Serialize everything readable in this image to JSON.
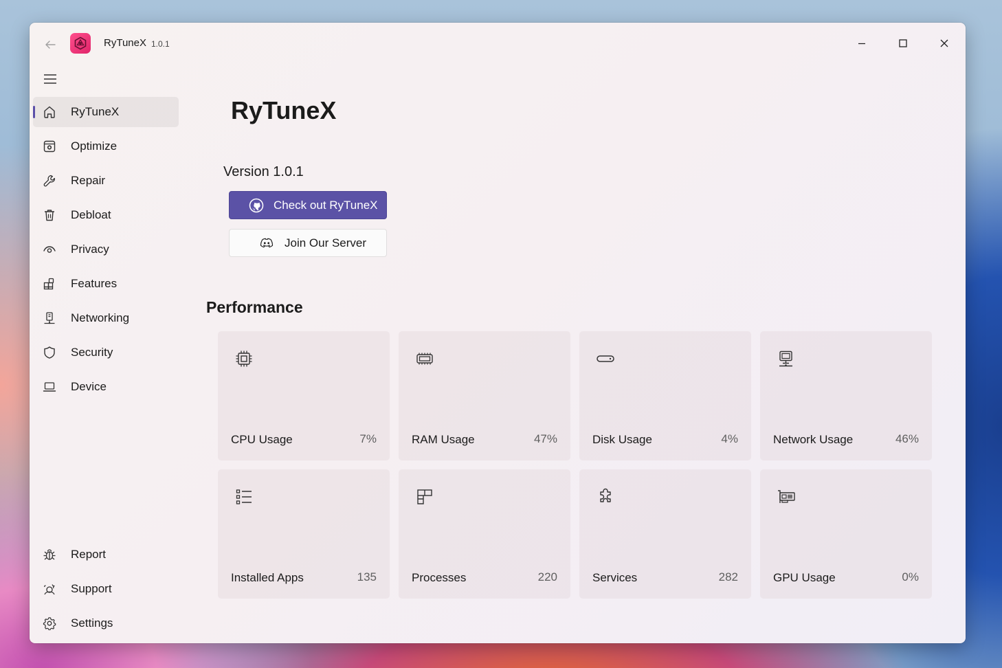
{
  "window": {
    "app_name": "RyTuneX",
    "app_version": "1.0.1"
  },
  "sidebar": {
    "items": [
      {
        "label": "RyTuneX",
        "icon": "home-icon",
        "selected": true
      },
      {
        "label": "Optimize",
        "icon": "optimize-icon"
      },
      {
        "label": "Repair",
        "icon": "wrench-icon"
      },
      {
        "label": "Debloat",
        "icon": "trash-icon"
      },
      {
        "label": "Privacy",
        "icon": "eye-icon"
      },
      {
        "label": "Features",
        "icon": "apps-add-icon"
      },
      {
        "label": "Networking",
        "icon": "network-icon"
      },
      {
        "label": "Security",
        "icon": "shield-icon"
      },
      {
        "label": "Device",
        "icon": "laptop-icon"
      }
    ],
    "footer_items": [
      {
        "label": "Report",
        "icon": "bug-icon"
      },
      {
        "label": "Support",
        "icon": "support-icon"
      },
      {
        "label": "Settings",
        "icon": "gear-icon"
      }
    ]
  },
  "main": {
    "title": "RyTuneX",
    "version_text": "Version 1.0.1",
    "github_button": "Check out RyTuneX",
    "discord_button": "Join Our Server",
    "performance_title": "Performance",
    "cards": [
      {
        "label": "CPU Usage",
        "value": "7%",
        "icon": "cpu-icon"
      },
      {
        "label": "RAM Usage",
        "value": "47%",
        "icon": "ram-icon"
      },
      {
        "label": "Disk Usage",
        "value": "4%",
        "icon": "disk-icon"
      },
      {
        "label": "Network Usage",
        "value": "46%",
        "icon": "network-monitor-icon"
      },
      {
        "label": "Installed Apps",
        "value": "135",
        "icon": "list-icon"
      },
      {
        "label": "Processes",
        "value": "220",
        "icon": "processes-icon"
      },
      {
        "label": "Services",
        "value": "282",
        "icon": "puzzle-icon"
      },
      {
        "label": "GPU Usage",
        "value": "0%",
        "icon": "gpu-icon"
      }
    ]
  },
  "colors": {
    "accent": "#5b52a6",
    "logo": "#e0246a"
  }
}
